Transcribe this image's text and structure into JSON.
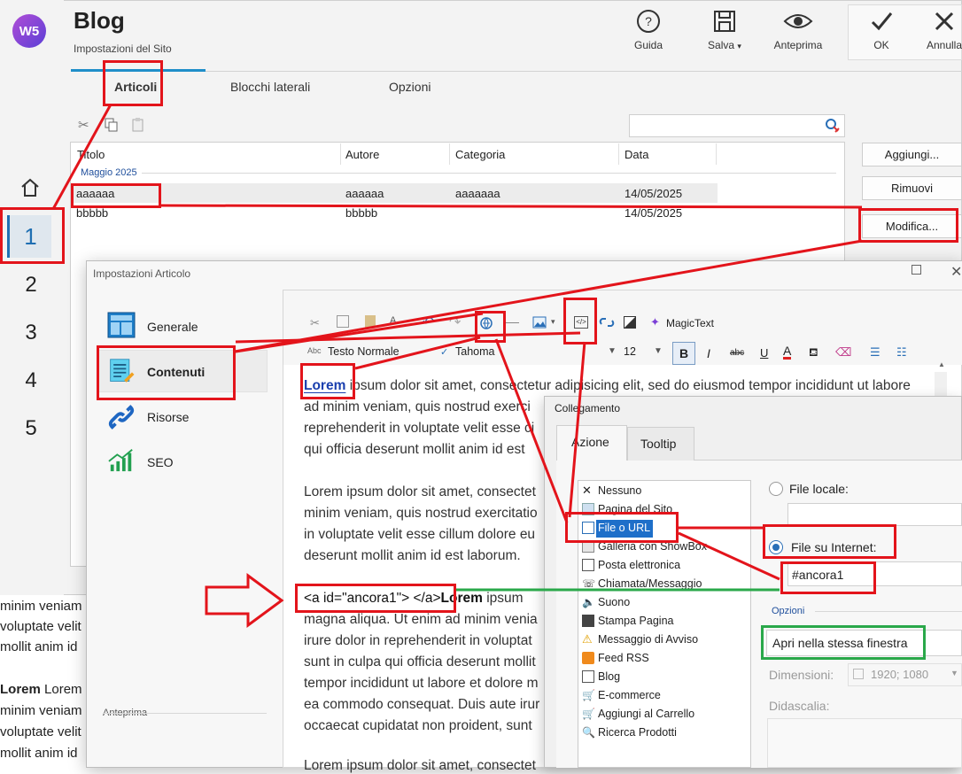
{
  "app": {
    "logo_text": "W5",
    "title": "Blog",
    "subtitle": "Impostazioni del Sito",
    "steps": [
      "1",
      "2",
      "3",
      "4",
      "5"
    ],
    "toolbar": {
      "guide": "Guida",
      "save": "Salva",
      "preview": "Anteprima",
      "ok": "OK",
      "cancel": "Annulla"
    },
    "tabs": [
      "Articoli",
      "Blocchi laterali",
      "Opzioni"
    ],
    "table": {
      "columns": [
        "Titolo",
        "Autore",
        "Categoria",
        "Data"
      ],
      "group": "Maggio 2025",
      "rows": [
        {
          "title": "aaaaaa",
          "author": "aaaaaa",
          "category": "aaaaaaa",
          "date": "14/05/2025"
        },
        {
          "title": "bbbbb",
          "author": "bbbbb",
          "category": "",
          "date": "14/05/2025"
        }
      ]
    },
    "buttons": {
      "add": "Aggiungi...",
      "remove": "Rimuovi",
      "edit": "Modifica..."
    }
  },
  "background_text": {
    "lines": [
      "minim veniam",
      "voluptate velit",
      "mollit anim id",
      "Lorem ipsum",
      "minim veniam",
      "voluptate velit",
      "mollit anim id"
    ]
  },
  "article_dialog": {
    "title": "Impostazioni Articolo",
    "nav": [
      "Generale",
      "Contenuti",
      "Risorse",
      "SEO"
    ],
    "preview_label": "Anteprima",
    "editor": {
      "magic_text": "MagicText",
      "style_value": "Testo Normale",
      "font_value": "Tahoma",
      "size_value": "12",
      "lines": [
        "ipsum dolor sit amet, consectetur adipisicing elit, sed do eiusmod tempor incididunt ut labore",
        "ad minim veniam, quis nostrud exerci",
        "reprehenderit in voluptate velit esse ci",
        "qui officia deserunt mollit anim id est",
        "Lorem ipsum dolor sit amet, consectet",
        "minim veniam, quis nostrud exercitatio",
        "in voluptate velit esse cillum dolore eu",
        "deserunt mollit anim id est laborum.",
        "<a id=\"ancora1\"> </a>",
        "ipsum",
        "magna aliqua. Ut enim ad minim venia",
        "irure dolor in reprehenderit in voluptat",
        "sunt in culpa qui officia deserunt mollit",
        "tempor incididunt ut labore et dolore m",
        "ea commodo consequat. Duis aute irur",
        "occaecat cupidatat non proident, sunt",
        "Lorem ipsum dolor sit amet, consectet"
      ],
      "bold_word": "Lorem"
    }
  },
  "link_dialog": {
    "title": "Collegamento",
    "tabs": [
      "Azione",
      "Tooltip"
    ],
    "actions": [
      "Nessuno",
      "Pagina del Sito",
      "File o URL",
      "Galleria con ShowBox",
      "Posta elettronica",
      "Chiamata/Messaggio",
      "Suono",
      "Stampa Pagina",
      "Messaggio di Avviso",
      "Feed RSS",
      "Blog",
      "E-commerce",
      "Aggiungi al Carrello",
      "Ricerca Prodotti"
    ],
    "local_file_label": "File locale:",
    "internet_file_label": "File su Internet:",
    "url_value": "#ancora1",
    "options_label": "Opzioni",
    "open_value": "Apri nella stessa finestra",
    "dimensions_label": "Dimensioni:",
    "dimensions_value": "1920; 1080",
    "caption_label": "Didascalia:"
  },
  "colors": {
    "accent": "#1f8ec9",
    "annotation_red": "#e3141b",
    "annotation_green": "#2aa84a",
    "selection": "#1e6fc9"
  }
}
